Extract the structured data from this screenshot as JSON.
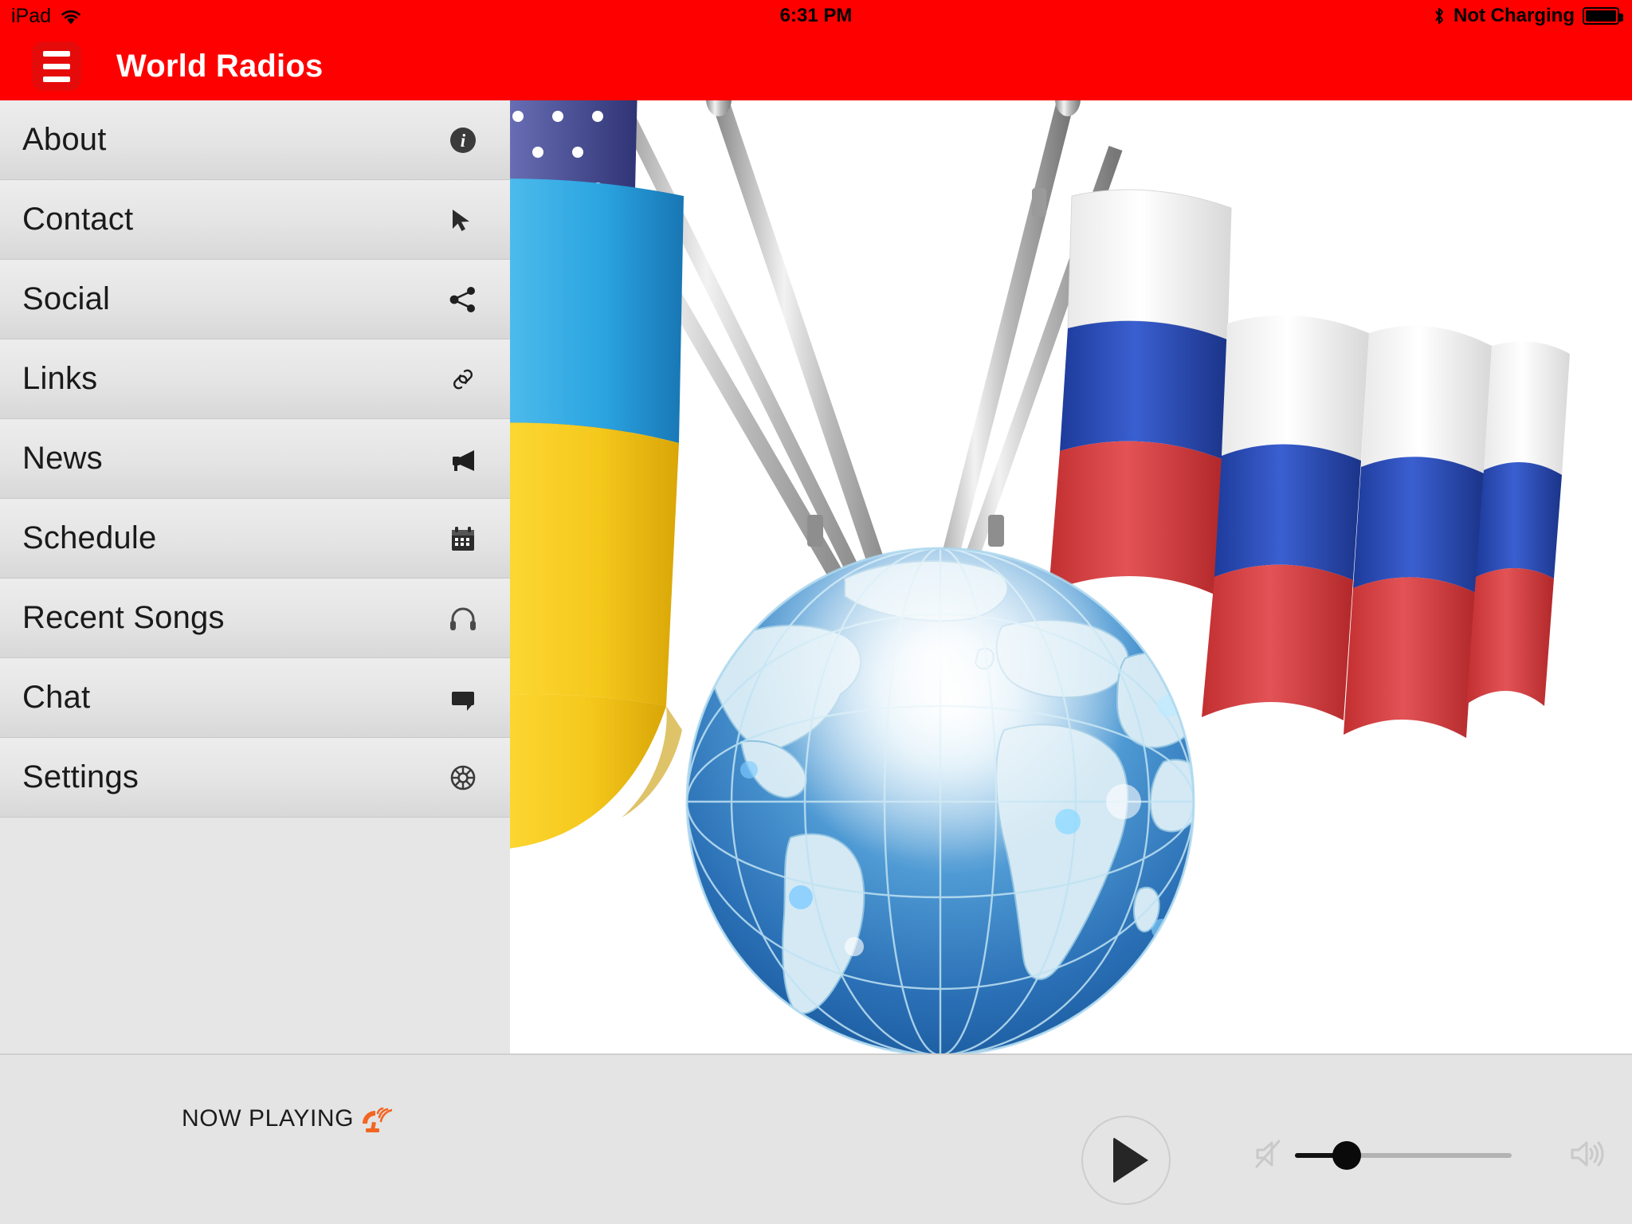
{
  "status_bar": {
    "device_label": "iPad",
    "wifi_icon": "wifi-icon",
    "time": "6:31 PM",
    "bluetooth_icon": "bluetooth-icon",
    "battery_status": "Not Charging",
    "battery_icon": "battery-icon",
    "battery_percent": 100,
    "background_color": "#FF0000",
    "text_color": "#000000"
  },
  "nav_bar": {
    "menu_button_icon": "hamburger-menu-icon",
    "title": "World Radios",
    "background_color": "#FF0000",
    "title_color": "#FFFFFF"
  },
  "sidebar": {
    "background_color": "#E6E6E6",
    "items": [
      {
        "label": "About",
        "icon": "info-circle-icon"
      },
      {
        "label": "Contact",
        "icon": "cursor-arrow-icon"
      },
      {
        "label": "Social",
        "icon": "share-nodes-icon"
      },
      {
        "label": "Links",
        "icon": "link-chain-icon"
      },
      {
        "label": "News",
        "icon": "megaphone-icon"
      },
      {
        "label": "Schedule",
        "icon": "calendar-icon"
      },
      {
        "label": "Recent Songs",
        "icon": "headphones-icon"
      },
      {
        "label": "Chat",
        "icon": "speech-bubble-icon"
      },
      {
        "label": "Settings",
        "icon": "gear-wheel-icon"
      }
    ]
  },
  "content": {
    "hero_image": "flags-and-globe-illustration",
    "hero_description": "Illustration of United States, Ukraine and Russia flags on metal poles above a blue world globe",
    "background_color": "#FFFFFF"
  },
  "player_bar": {
    "now_playing_label": "NOW PLAYING",
    "now_playing_icon": "broadcast-antenna-icon",
    "now_playing_icon_color": "#F26522",
    "play_button_icon": "play-icon",
    "mute_icon": "speaker-mute-icon",
    "volume_icon": "speaker-volume-icon",
    "volume_percent": 24,
    "background_color": "#E4E4E4"
  }
}
